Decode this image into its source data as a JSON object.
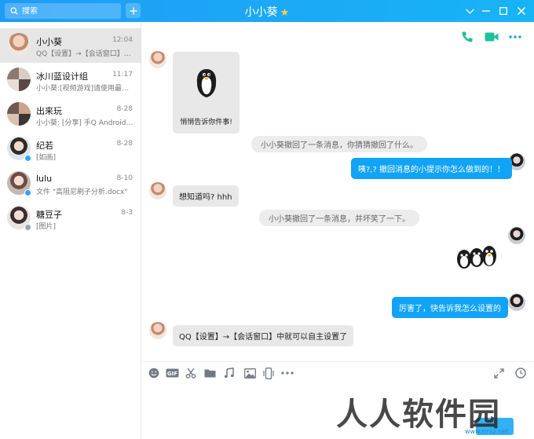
{
  "titlebar": {
    "search_placeholder": "搜索",
    "title": "小小葵",
    "star": "★"
  },
  "contacts": [
    {
      "name": "小小葵",
      "time": "12:04",
      "preview": "QQ【设置】→【会话窗口】中…"
    },
    {
      "name": "冰川蓝设计组",
      "time": "11:17",
      "preview": "小小葵:[视频游戏]请使用最新…"
    },
    {
      "name": "出来玩",
      "time": "8-28",
      "preview": "小小葵: [分享] 手Q Android版…"
    },
    {
      "name": "纪若",
      "time": "8-28",
      "preview": "[如画]"
    },
    {
      "name": "lulu",
      "time": "8-10",
      "preview": "文件 \"高阻尼刷子分析.docx\""
    },
    {
      "name": "糖豆子",
      "time": "8-3",
      "preview": "[图片]"
    }
  ],
  "messages": {
    "card_text": "悄悄告诉你件事!",
    "sys1": "小小葵撤回了一条消息，你猜猜撤回了什么。",
    "right1": "咦?,? 撤回消息的小提示你怎么做到的！！",
    "left1": "想知道吗? hhh",
    "sys2": "小小葵撤回了一条消息，并坏笑了一下。",
    "right2": "厉害了，快告诉我怎么设置的",
    "left2": "QQ【设置】→【会话窗口】中就可以自主设置了"
  },
  "watermark": {
    "text": "人人软件园",
    "url": "www.rrrxz.net"
  },
  "colors": {
    "accent": "#11a3f5",
    "titlebar": "#1f9cf6",
    "call_green": "#1fc29a"
  }
}
